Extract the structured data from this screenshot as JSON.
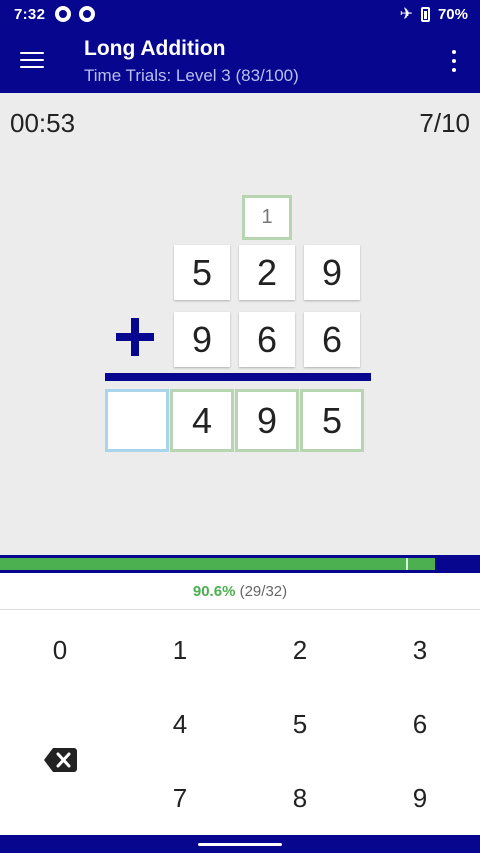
{
  "status_bar": {
    "time": "7:32",
    "battery": "70%"
  },
  "app_bar": {
    "title": "Long Addition",
    "subtitle": "Time Trials: Level 3 (83/100)"
  },
  "timer": "00:53",
  "question_progress": "7/10",
  "problem": {
    "carry": "1",
    "top_digits": [
      "5",
      "2",
      "9"
    ],
    "bottom_digits": [
      "9",
      "6",
      "6"
    ],
    "answer_digits": [
      "",
      "4",
      "9",
      "5"
    ]
  },
  "progress_bar": {
    "fraction": 0.906
  },
  "stats": {
    "percent": "90.6%",
    "count": "(29/32)"
  },
  "keypad": {
    "keys": [
      "0",
      "1",
      "2",
      "3",
      "4",
      "5",
      "6",
      "7",
      "8",
      "9"
    ]
  },
  "colors": {
    "primary": "#06068f",
    "success": "#4caf50",
    "carry_border": "#b7d5b1",
    "active_border": "#a9d4e9"
  },
  "icons": [
    "menu-icon",
    "more-vert-icon",
    "backspace-icon",
    "airplane-icon",
    "battery-icon"
  ]
}
